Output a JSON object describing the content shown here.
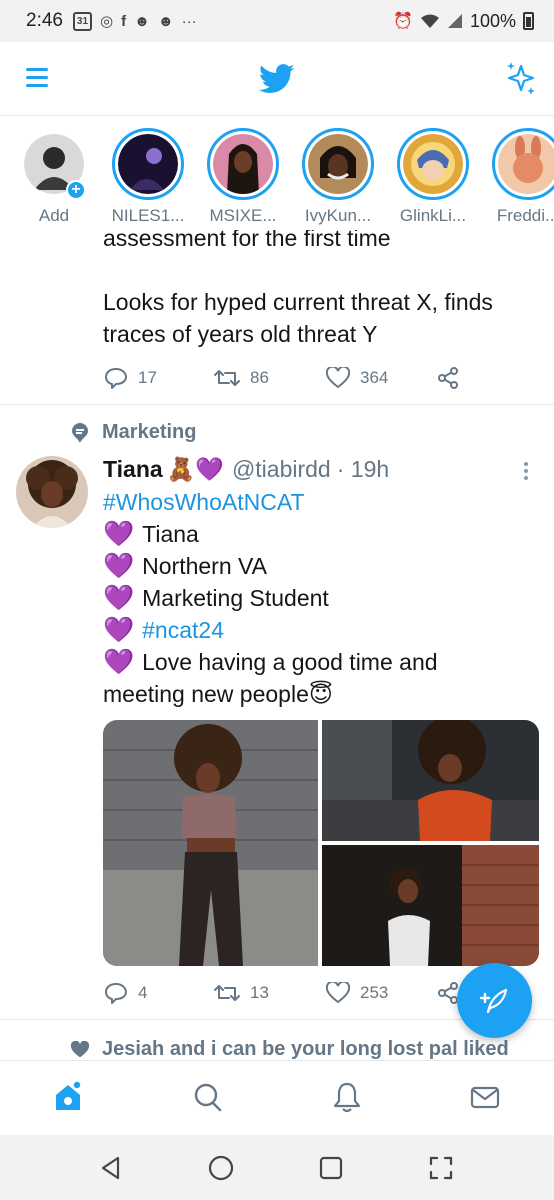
{
  "status_bar": {
    "time": "2:46",
    "calendar_day": "31",
    "battery": "100%"
  },
  "colors": {
    "accent": "#1da1f2",
    "text_primary": "#14171a",
    "text_secondary": "#657786",
    "heart_purple": "#a98bd8"
  },
  "fleets": [
    {
      "label": "Add",
      "icon": "add-fleet"
    },
    {
      "label": "NILES1..."
    },
    {
      "label": "MSIXE..."
    },
    {
      "label": "IvyKun..."
    },
    {
      "label": "GlinkLi..."
    },
    {
      "label": "Freddi..."
    }
  ],
  "previous_tweet": {
    "line1": "assessment for the first time",
    "line2": "Looks for hyped current threat X, finds traces of years old threat Y",
    "replies": "17",
    "retweets": "86",
    "likes": "364"
  },
  "tweet": {
    "social_context": "Marketing",
    "display_name": "Tiana",
    "name_emojis": "🧸💜",
    "handle": "@tiabirdd",
    "time": "· 19h",
    "hashtag": "#WhosWhoAtNCAT",
    "heart": "💜",
    "lines": [
      "Tiana",
      "Northern VA",
      "Marketing Student"
    ],
    "hashtag2": "#ncat24",
    "last_line_a": "Love having a good time and",
    "last_line_b": "meeting new people😇",
    "replies": "4",
    "retweets": "13",
    "likes": "253"
  },
  "next_tweet": {
    "social_context": "Jesiah and i can be your long lost pal liked"
  }
}
